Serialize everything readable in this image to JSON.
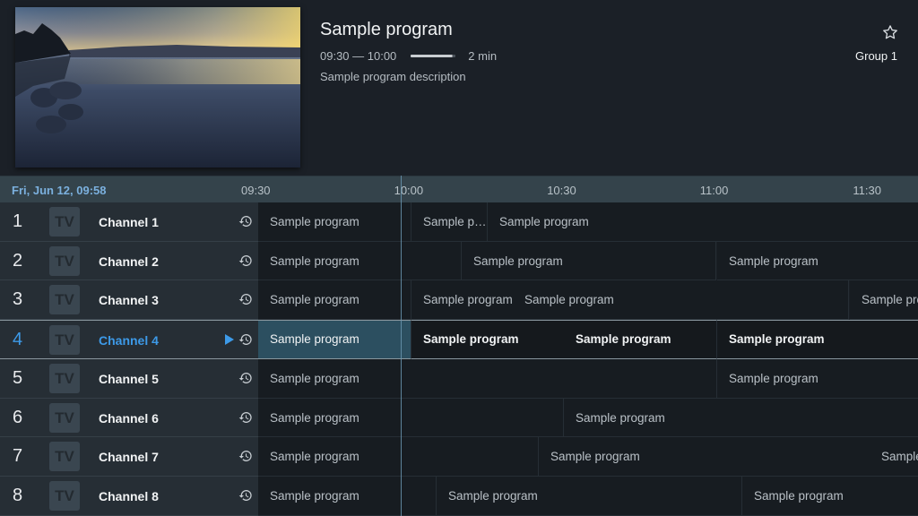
{
  "program_info": {
    "title": "Sample program",
    "time_range": "09:30 — 10:00",
    "progress_fraction": 0.93,
    "remaining": "2 min",
    "description": "Sample program description",
    "favorite_icon": "star-outline-icon",
    "group_label": "Group 1"
  },
  "timeline": {
    "current_datetime": "Fri, Jun 12, 09:58",
    "ticks": [
      "09:30",
      "10:00",
      "10:30",
      "11:00",
      "11:30"
    ],
    "start_minutes": 570,
    "now_minutes": 598,
    "minutes_per_tick": 30
  },
  "colors": {
    "accent": "#3d9ae8",
    "date_text": "#7bb0de",
    "selected_program_bg": "#2c4f60"
  },
  "channels": [
    {
      "number": "1",
      "logo": "TV",
      "name": "Channel 1",
      "selected": false,
      "programs": [
        {
          "title": "Sample program",
          "start": 570,
          "end": 600
        },
        {
          "title": "Sample program",
          "start": 600,
          "end": 615
        },
        {
          "title": "Sample program",
          "start": 615,
          "end": 760
        }
      ]
    },
    {
      "number": "2",
      "logo": "TV",
      "name": "Channel 2",
      "selected": false,
      "programs": [
        {
          "title": "Sample program",
          "start": 570,
          "end": 610
        },
        {
          "title": "Sample program",
          "start": 610,
          "end": 660
        },
        {
          "title": "Sample program",
          "start": 660,
          "end": 760
        }
      ]
    },
    {
      "number": "3",
      "logo": "TV",
      "name": "Channel 3",
      "selected": false,
      "programs": [
        {
          "title": "Sample program",
          "start": 570,
          "end": 600
        },
        {
          "title": "Sample program",
          "start": 600,
          "end": 620
        },
        {
          "title": "Sample program",
          "start": 620,
          "end": 686
        },
        {
          "title": "Sample program",
          "start": 686,
          "end": 760
        }
      ]
    },
    {
      "number": "4",
      "logo": "TV",
      "name": "Channel 4",
      "selected": true,
      "programs": [
        {
          "title": "Sample program",
          "start": 570,
          "end": 600,
          "current": true
        },
        {
          "title": "Sample program",
          "start": 600,
          "end": 630
        },
        {
          "title": "Sample program",
          "start": 630,
          "end": 660
        },
        {
          "title": "Sample program",
          "start": 660,
          "end": 760
        }
      ]
    },
    {
      "number": "5",
      "logo": "TV",
      "name": "Channel 5",
      "selected": false,
      "programs": [
        {
          "title": "Sample program",
          "start": 570,
          "end": 660
        },
        {
          "title": "Sample program",
          "start": 660,
          "end": 760
        }
      ]
    },
    {
      "number": "6",
      "logo": "TV",
      "name": "Channel 6",
      "selected": false,
      "programs": [
        {
          "title": "Sample program",
          "start": 570,
          "end": 630
        },
        {
          "title": "Sample program",
          "start": 630,
          "end": 760
        }
      ]
    },
    {
      "number": "7",
      "logo": "TV",
      "name": "Channel 7",
      "selected": false,
      "programs": [
        {
          "title": "Sample program",
          "start": 570,
          "end": 625
        },
        {
          "title": "Sample program",
          "start": 625,
          "end": 690
        },
        {
          "title": "Sample program",
          "start": 690,
          "end": 760
        }
      ]
    },
    {
      "number": "8",
      "logo": "TV",
      "name": "Channel 8",
      "selected": false,
      "programs": [
        {
          "title": "Sample program",
          "start": 570,
          "end": 605
        },
        {
          "title": "Sample program",
          "start": 605,
          "end": 665
        },
        {
          "title": "Sample program",
          "start": 665,
          "end": 760
        }
      ]
    }
  ]
}
